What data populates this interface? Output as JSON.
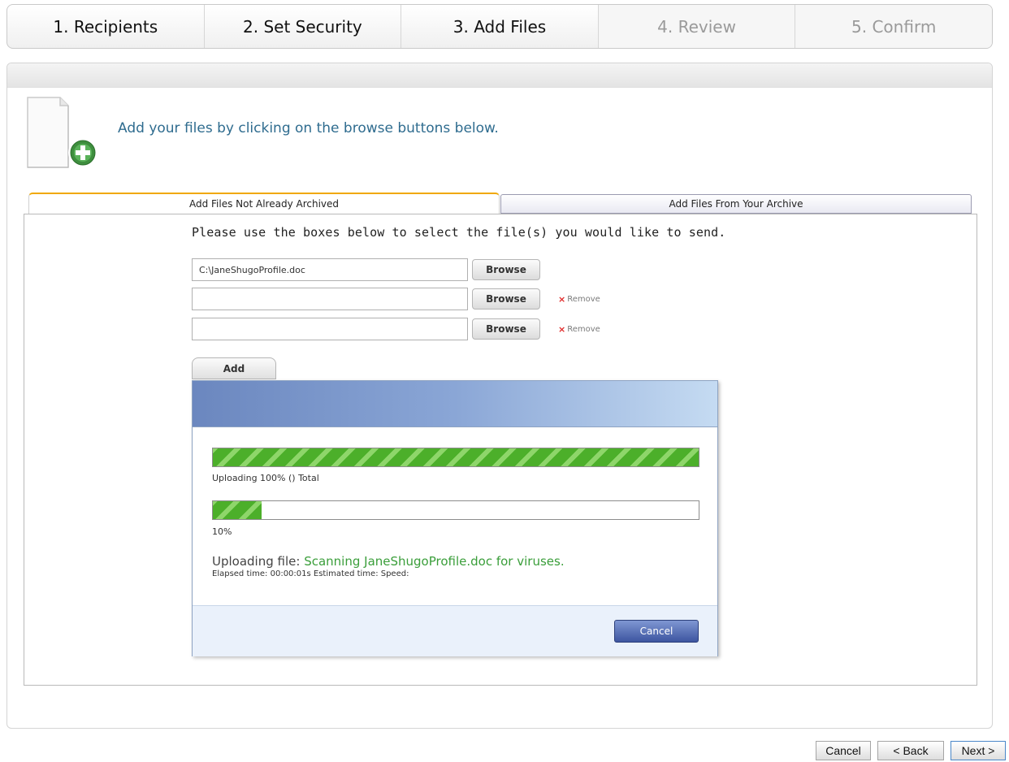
{
  "steps": [
    {
      "label": "1. Recipients",
      "state": "active"
    },
    {
      "label": "2. Set Security",
      "state": "active"
    },
    {
      "label": "3. Add Files",
      "state": "current"
    },
    {
      "label": "4. Review",
      "state": "inactive"
    },
    {
      "label": "5. Confirm",
      "state": "inactive"
    }
  ],
  "intro": {
    "text": "Add your files by clicking on the browse buttons below.",
    "icon": "document-add-icon"
  },
  "tabs": {
    "active": "Add Files Not Already Archived",
    "inactive": "Add Files From Your Archive"
  },
  "instructions": "Please use the boxes below to select the file(s) you would like to send.",
  "files": [
    {
      "value": "C:\\JaneShugoProfile.doc",
      "browse": "Browse"
    },
    {
      "value": "",
      "browse": "Browse",
      "remove": "Remove"
    },
    {
      "value": "",
      "browse": "Browse",
      "remove": "Remove"
    }
  ],
  "add_label": "Add",
  "upload": {
    "total_progress": 100,
    "total_label": "Uploading 100% () Total",
    "file_progress": 10,
    "file_label": "10%",
    "file_prefix": "Uploading file: ",
    "file_status": "Scanning JaneShugoProfile.doc for viruses.",
    "elapsed": "Elapsed time: 00:00:01s Estimated time:  Speed:",
    "cancel_label": "Cancel"
  },
  "nav": {
    "cancel": "Cancel",
    "back": "< Back",
    "next": "Next >"
  },
  "colors": {
    "progress_green": "#4caf2a",
    "tab_accent": "#f0a800",
    "title_blue": "#2f6c8f",
    "status_green": "#3a9e3a"
  }
}
